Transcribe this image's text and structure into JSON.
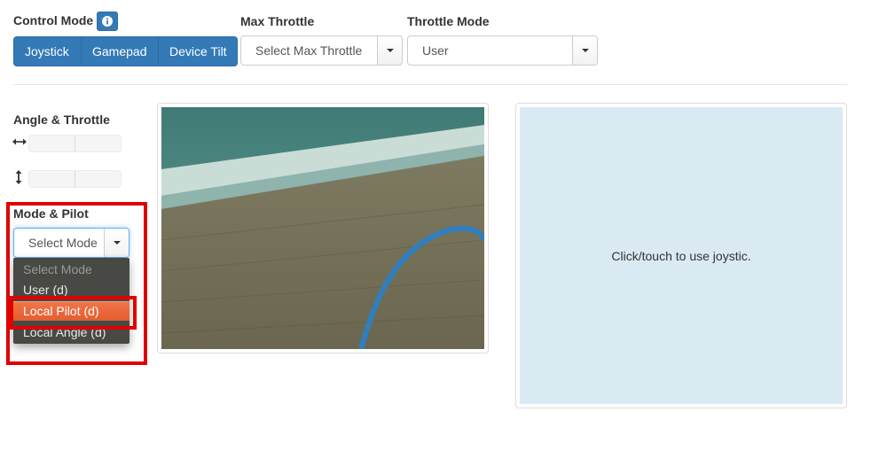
{
  "control_mode": {
    "label": "Control Mode",
    "info_icon": "info-icon",
    "buttons": [
      "Joystick",
      "Gamepad",
      "Device Tilt"
    ]
  },
  "max_throttle": {
    "label": "Max Throttle",
    "value": "Select Max Throttle"
  },
  "throttle_mode": {
    "label": "Throttle Mode",
    "value": "User"
  },
  "angle_throttle": {
    "label": "Angle & Throttle",
    "horizontal_icon": "left-right-arrow-icon",
    "vertical_icon": "up-down-arrow-icon"
  },
  "mode_pilot": {
    "label": "Mode & Pilot",
    "value": "Select Mode",
    "options": [
      "Select Mode",
      "User (d)",
      "Local Pilot (d)",
      "Local Angle (d)"
    ],
    "highlighted_option": "Local Pilot (d)"
  },
  "joystick_pad": {
    "text": "Click/touch to use joystic."
  },
  "colors": {
    "primary": "#337ab7",
    "highlight_box": "#e00000",
    "selected_option": "#e8603a",
    "joystick_bg": "#d9eaf3"
  }
}
